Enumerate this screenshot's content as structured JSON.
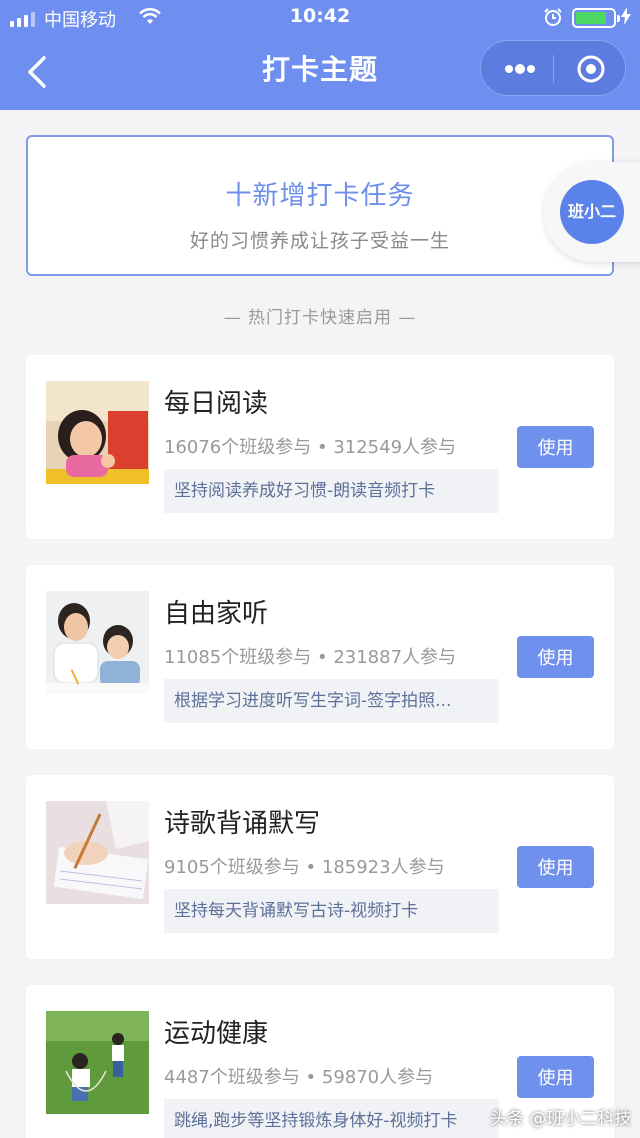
{
  "status_bar": {
    "carrier": "中国移动",
    "time": "10:42",
    "battery_color": "#4cd964"
  },
  "nav": {
    "title": "打卡主题",
    "back_icon": "chevron-left-icon",
    "more_icon": "more-dots-icon",
    "close_icon": "target-circle-icon",
    "bar_color": "#6f8ff0"
  },
  "new_task": {
    "title": "十新增打卡任务",
    "subtitle": "好的习惯养成让孩子受益一生"
  },
  "floating_badge": {
    "label": "班小二"
  },
  "section": {
    "title": "— 热门打卡快速启用 —"
  },
  "cards": [
    {
      "name": "每日阅读",
      "stats": "16076个班级参与 • 312549人参与",
      "desc": "坚持阅读养成好习惯-朗读音频打卡",
      "button": "使用",
      "thumb": "girl-reading-photo"
    },
    {
      "name": "自由家听",
      "stats": "11085个班级参与 • 231887人参与",
      "desc": "根据学习进度听写生字词-签字拍照...",
      "button": "使用",
      "thumb": "father-son-writing-photo"
    },
    {
      "name": "诗歌背诵默写",
      "stats": "9105个班级参与 • 185923人参与",
      "desc": "坚持每天背诵默写古诗-视频打卡",
      "button": "使用",
      "thumb": "hand-writing-pen-photo"
    },
    {
      "name": "运动健康",
      "stats": "4487个班级参与 • 59870人参与",
      "desc": "跳绳,跑步等坚持锻炼身体好-视频打卡",
      "button": "使用",
      "thumb": "kids-jump-rope-photo"
    }
  ],
  "watermark": "头条 @班小二科技",
  "accent_color": "#7090ee"
}
